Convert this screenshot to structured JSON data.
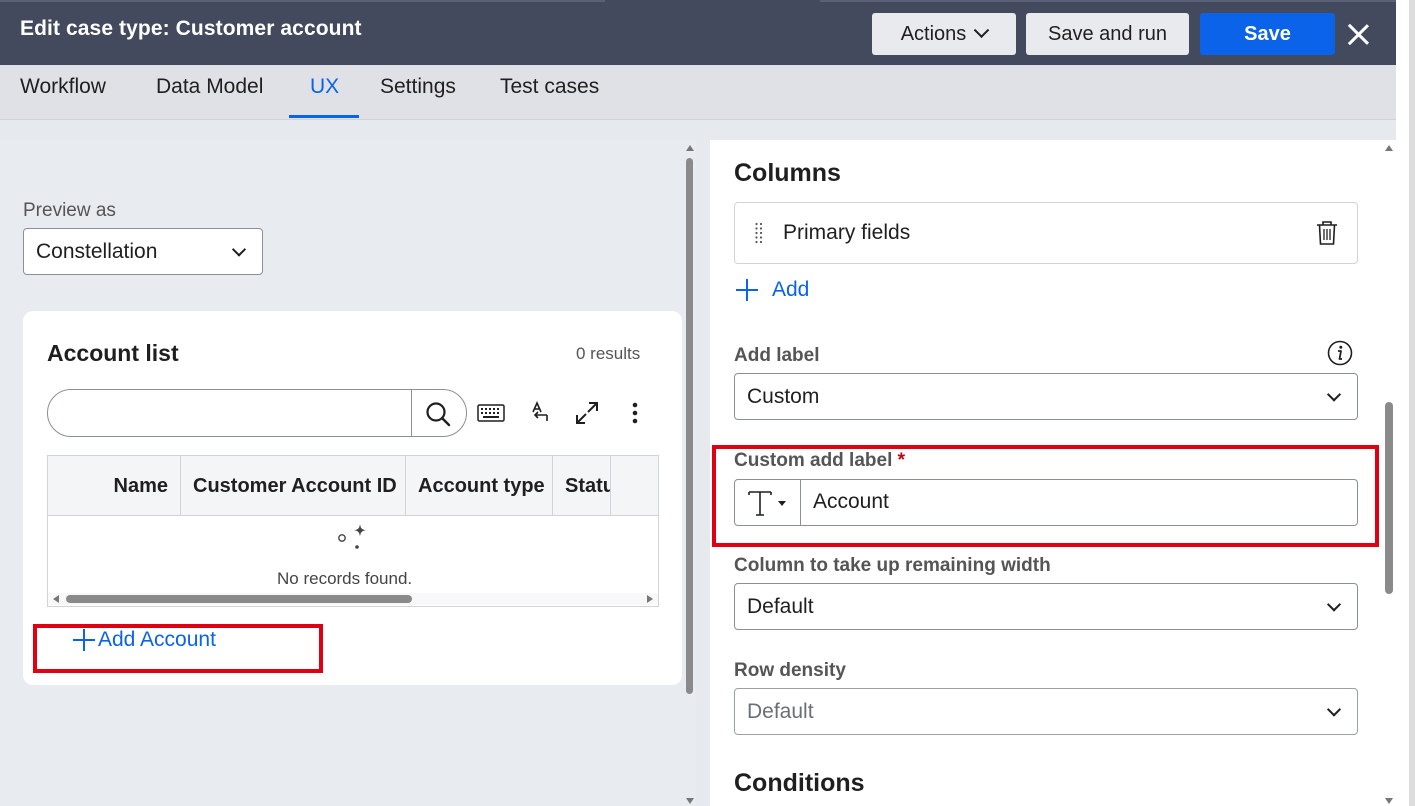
{
  "header": {
    "title": "Edit case type:  Customer account",
    "actions_label": "Actions",
    "save_and_run_label": "Save and run",
    "save_label": "Save"
  },
  "tabs": [
    {
      "label": "Workflow"
    },
    {
      "label": "Data Model"
    },
    {
      "label": "UX",
      "active": true
    },
    {
      "label": "Settings"
    },
    {
      "label": "Test cases"
    }
  ],
  "preview": {
    "label": "Preview as",
    "value": "Constellation"
  },
  "account_list": {
    "title": "Account list",
    "results": "0 results",
    "search_placeholder": "",
    "columns": [
      "Name",
      "Customer Account ID",
      "Account type",
      "Statu"
    ],
    "empty_message": "No records found.",
    "add_label": "Add Account"
  },
  "config": {
    "columns_title": "Columns",
    "primary_fields": "Primary fields",
    "add_label": "Add",
    "add_label_field": {
      "label": "Add label",
      "value": "Custom"
    },
    "custom_add_label": {
      "label": "Custom add label",
      "required_mark": "*",
      "value": "Account"
    },
    "remaining_width": {
      "label": "Column to take up remaining width",
      "value": "Default"
    },
    "row_density": {
      "label": "Row density",
      "value": "Default"
    },
    "conditions_title": "Conditions"
  },
  "colors": {
    "header_bg": "#444a5e",
    "accent_blue": "#0a63e8",
    "highlight_red": "#e00012"
  }
}
